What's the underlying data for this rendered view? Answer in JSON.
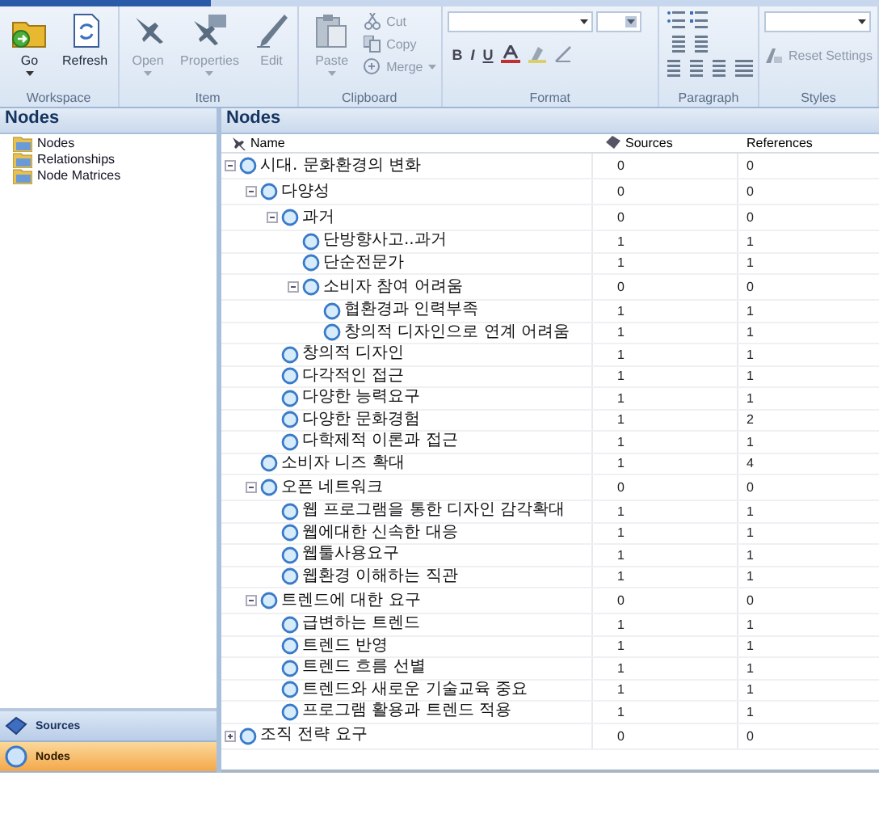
{
  "ribbon": {
    "groups": [
      {
        "kind": "large",
        "label": "Workspace",
        "buttons": [
          {
            "label": "Go",
            "disabled": false,
            "dropdown": true
          },
          {
            "label": "Refresh",
            "disabled": false,
            "dropdown": false
          }
        ]
      },
      {
        "kind": "large",
        "label": "Item",
        "buttons": [
          {
            "label": "Open",
            "disabled": true,
            "dropdown": true
          },
          {
            "label": "Properties",
            "disabled": true,
            "dropdown": true
          },
          {
            "label": "Edit",
            "disabled": true,
            "dropdown": false
          }
        ]
      },
      {
        "kind": "clipboard",
        "label": "Clipboard",
        "paste": {
          "label": "Paste",
          "disabled": true,
          "dropdown": true
        },
        "small": [
          {
            "label": "Cut",
            "disabled": true,
            "dropdown": false
          },
          {
            "label": "Copy",
            "disabled": true,
            "dropdown": false
          },
          {
            "label": "Merge",
            "disabled": true,
            "dropdown": true
          }
        ]
      },
      {
        "kind": "format",
        "label": "Format",
        "toggles": [
          {
            "label": "B"
          },
          {
            "label": "I"
          },
          {
            "label": "U"
          }
        ]
      },
      {
        "kind": "paragraph",
        "label": "Paragraph"
      },
      {
        "kind": "styles",
        "label": "Styles",
        "reset": {
          "label": "Reset Settings",
          "disabled": true
        }
      }
    ]
  },
  "left_panel": {
    "title": "Nodes",
    "items": [
      {
        "label": "Nodes",
        "selected": false
      },
      {
        "label": "Relationships",
        "selected": false
      },
      {
        "label": "Node Matrices",
        "selected": false
      }
    ],
    "navigation": [
      {
        "label": "Sources",
        "selected": false
      },
      {
        "label": "Nodes",
        "selected": true
      }
    ]
  },
  "main": {
    "title": "Nodes",
    "columns": [
      "Name",
      "Sources",
      "References"
    ],
    "nodes": [
      {
        "name": "시대. 문화환경의 변화",
        "sources": "0",
        "references": "0",
        "expanded": true,
        "children": [
          {
            "name": "다양성",
            "sources": "0",
            "references": "0",
            "expanded": true,
            "children": [
              {
                "name": "과거",
                "sources": "0",
                "references": "0",
                "expanded": true,
                "children": [
                  {
                    "name": "단방향사고..과거",
                    "sources": "1",
                    "references": "1"
                  },
                  {
                    "name": "단순전문가",
                    "sources": "1",
                    "references": "1"
                  },
                  {
                    "name": "소비자 참여 어려움",
                    "sources": "0",
                    "references": "0",
                    "expanded": true,
                    "children": [
                      {
                        "name": "협환경과 인력부족",
                        "sources": "1",
                        "references": "1"
                      },
                      {
                        "name": "창의적 디자인으로 연계 어려움",
                        "sources": "1",
                        "references": "1"
                      }
                    ]
                  }
                ]
              },
              {
                "name": "창의적 디자인",
                "sources": "1",
                "references": "1"
              },
              {
                "name": "다각적인 접근",
                "sources": "1",
                "references": "1"
              },
              {
                "name": "다양한 능력요구",
                "sources": "1",
                "references": "1"
              },
              {
                "name": "다양한 문화경험",
                "sources": "1",
                "references": "2"
              },
              {
                "name": "다학제적 이론과 접근",
                "sources": "1",
                "references": "1"
              }
            ]
          },
          {
            "name": "소비자 니즈 확대",
            "sources": "1",
            "references": "4"
          },
          {
            "name": "오픈 네트워크",
            "sources": "0",
            "references": "0",
            "expanded": true,
            "children": [
              {
                "name": "웹 프로그램을 통한 디자인 감각확대",
                "sources": "1",
                "references": "1"
              },
              {
                "name": "웹에대한 신속한 대응",
                "sources": "1",
                "references": "1"
              },
              {
                "name": "웹툴사용요구",
                "sources": "1",
                "references": "1"
              },
              {
                "name": "웹환경 이해하는 직관",
                "sources": "1",
                "references": "1"
              }
            ]
          },
          {
            "name": "트렌드에 대한 요구",
            "sources": "0",
            "references": "0",
            "expanded": true,
            "children": [
              {
                "name": "급변하는 트렌드",
                "sources": "1",
                "references": "1"
              },
              {
                "name": "트렌드 반영",
                "sources": "1",
                "references": "1"
              },
              {
                "name": "트렌드 흐름 선별",
                "sources": "1",
                "references": "1"
              },
              {
                "name": "트렌드와 새로운 기술교육 중요",
                "sources": "1",
                "references": "1"
              },
              {
                "name": "프로그램 활용과 트렌드 적용",
                "sources": "1",
                "references": "1"
              }
            ]
          }
        ]
      },
      {
        "name": "조직 전략 요구",
        "sources": "0",
        "references": "0",
        "expanded": false
      }
    ]
  }
}
